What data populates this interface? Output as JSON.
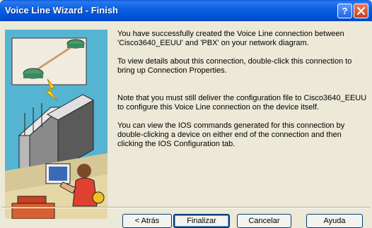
{
  "window": {
    "title": "Voice Line Wizard - Finish"
  },
  "titlebar_buttons": {
    "help_icon": "question-mark",
    "close_icon": "x"
  },
  "content": {
    "paragraphs": [
      "You have successfully created the Voice Line connection between 'Cisco3640_EEUU' and 'PBX' on your network diagram.",
      "To view details about this connection, double-click this connection to bring up Connection Properties.",
      "Note that you must still deliver the configuration file to Cisco3640_EEUU to configure this Voice Line connection on the device itself.",
      "You can view the IOS commands generated for this connection by double-clicking a device on either end of the connection  and then clicking the IOS Configuration tab."
    ]
  },
  "buttons": {
    "back": "< Atrás",
    "finish": "Finalizar",
    "cancel": "Cancelar",
    "help": "Ayuda"
  },
  "colors": {
    "titlebar": "#0a5fe0",
    "illustration_bg": "#4db0cf",
    "dialog_bg": "#ece9d8"
  }
}
